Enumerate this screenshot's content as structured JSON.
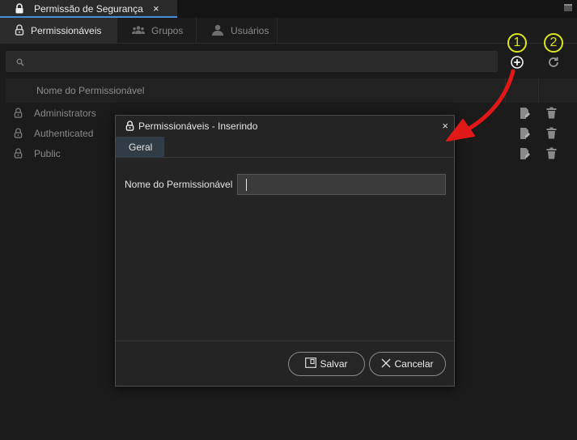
{
  "window_tab": {
    "title": "Permissão de Segurança",
    "close_glyph": "×",
    "icon": "lock-icon"
  },
  "tabs": [
    {
      "label": "Permissionáveis",
      "icon": "lock-open-icon",
      "active": true
    },
    {
      "label": "Grupos",
      "icon": "group-icon",
      "active": false
    },
    {
      "label": "Usuários",
      "icon": "user-icon",
      "active": false
    }
  ],
  "search": {
    "placeholder": "",
    "value": ""
  },
  "toolbar": {
    "add_icon": "plus-circle-icon",
    "refresh_icon": "refresh-icon"
  },
  "annotations": [
    "1",
    "2"
  ],
  "grid": {
    "columns": [
      "Nome do Permissionável"
    ],
    "rows": [
      {
        "label": "Administrators"
      },
      {
        "label": "Authenticated"
      },
      {
        "label": "Public"
      }
    ]
  },
  "modal": {
    "title": "Permissionáveis - Inserindo",
    "close_glyph": "×",
    "tab": "Geral",
    "field_label": "Nome do Permissionável",
    "field_value": "",
    "save_label": "Salvar",
    "cancel_label": "Cancelar"
  },
  "colors": {
    "accent": "#4a8cdb",
    "annotation": "#dce61c",
    "arrow": "#e01818",
    "background": "#1b1b1b"
  }
}
